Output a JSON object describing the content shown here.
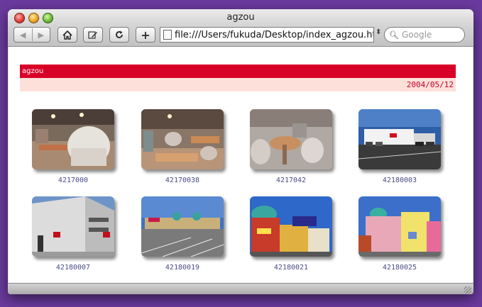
{
  "window": {
    "title": "agzou"
  },
  "toolbar": {
    "back_icon": "back-arrow-icon",
    "forward_icon": "forward-arrow-icon",
    "home_icon": "home-icon",
    "edit_icon": "pencil-icon",
    "reload_icon": "reload-icon",
    "add_label": "+",
    "url": "file:///Users/fukuda/Desktop/index_agzou.htm",
    "search_placeholder": "Google"
  },
  "page": {
    "header_title": "agzou",
    "date": "2004/05/12",
    "header_color": "#d90027",
    "date_bg_color": "#fde0da",
    "photos": [
      {
        "caption": "4217000"
      },
      {
        "caption": "42170038"
      },
      {
        "caption": "4217042"
      },
      {
        "caption": "42180003"
      },
      {
        "caption": "42180007"
      },
      {
        "caption": "42180019"
      },
      {
        "caption": "42180021"
      },
      {
        "caption": "42180025"
      }
    ]
  }
}
